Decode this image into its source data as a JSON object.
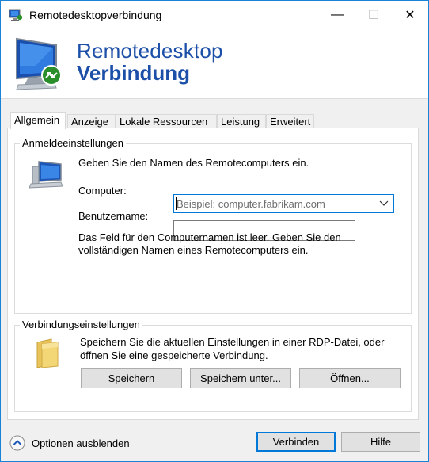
{
  "window": {
    "title": "Remotedesktopverbindung",
    "minimize_glyph": "—",
    "maximize_glyph": "☐",
    "close_glyph": "✕"
  },
  "banner": {
    "line1": "Remotedesktop",
    "line2": "Verbindung"
  },
  "tabs": [
    {
      "label": "Allgemein",
      "active": true
    },
    {
      "label": "Anzeige",
      "active": false
    },
    {
      "label": "Lokale Ressourcen",
      "active": false
    },
    {
      "label": "Leistung",
      "active": false
    },
    {
      "label": "Erweitert",
      "active": false
    }
  ],
  "logon": {
    "title": "Anmeldeeinstellungen",
    "intro": "Geben Sie den Namen des Remotecomputers ein.",
    "computer_label": "Computer:",
    "computer_value": "",
    "computer_placeholder": "Beispiel: computer.fabrikam.com",
    "username_label": "Benutzername:",
    "username_value": "",
    "hint_line1": "Das Feld für den Computernamen ist leer. Geben Sie den",
    "hint_line2": "vollständigen Namen eines Remotecomputers ein."
  },
  "connection": {
    "title": "Verbindungseinstellungen",
    "desc_line1": "Speichern Sie die aktuellen Einstellungen in einer RDP-Datei, oder",
    "desc_line2": "öffnen Sie eine gespeicherte Verbindung.",
    "save_label": "Speichern",
    "save_as_label": "Speichern unter...",
    "open_label": "Öffnen..."
  },
  "footer": {
    "options_label": "Optionen ausblenden",
    "connect_label": "Verbinden",
    "help_label": "Hilfe"
  },
  "colors": {
    "accent": "#0078d7",
    "banner_text": "#1c4fa8"
  },
  "icons": [
    "rdp-app-icon",
    "rdp-monitor-logo",
    "computer-icon",
    "folder-icon",
    "chevron-down-icon",
    "collapse-up-icon"
  ]
}
